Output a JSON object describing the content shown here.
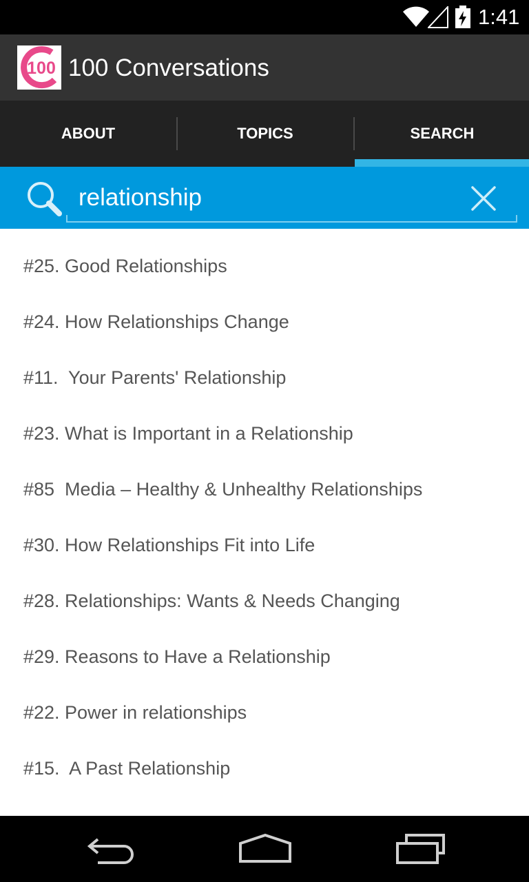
{
  "status_bar": {
    "time": "1:41",
    "icons": [
      "wifi-icon",
      "cell-signal-icon",
      "battery-charging-icon"
    ]
  },
  "app": {
    "title": "100 Conversations",
    "logo_text": "100",
    "logo_icon": "app-logo-100-icon"
  },
  "tabs": [
    {
      "label": "ABOUT",
      "selected": false
    },
    {
      "label": "TOPICS",
      "selected": false
    },
    {
      "label": "SEARCH",
      "selected": true
    }
  ],
  "search": {
    "value": "relationship",
    "icons": [
      "search-icon",
      "close-icon"
    ]
  },
  "results": [
    "#25. Good Relationships",
    "#24. How Relationships Change",
    "#11.  Your Parents' Relationship",
    "#23. What is Important in a Relationship",
    "#85  Media – Healthy & Unhealthy Relationships",
    "#30. How Relationships Fit into Life",
    "#28. Relationships: Wants & Needs Changing",
    "#29. Reasons to Have a Relationship",
    "#22. Power in relationships",
    "#15.  A Past Relationship"
  ],
  "nav_bar": {
    "icons": [
      "back-icon",
      "home-icon",
      "recent-apps-icon"
    ]
  },
  "colors": {
    "status_bar": "#000000",
    "action_bar": "#333333",
    "tab_bar": "#222222",
    "tab_indicator": "#33b5e5",
    "search_bar": "#0099dd",
    "result_text": "#555555",
    "logo_pink": "#e8498a"
  }
}
